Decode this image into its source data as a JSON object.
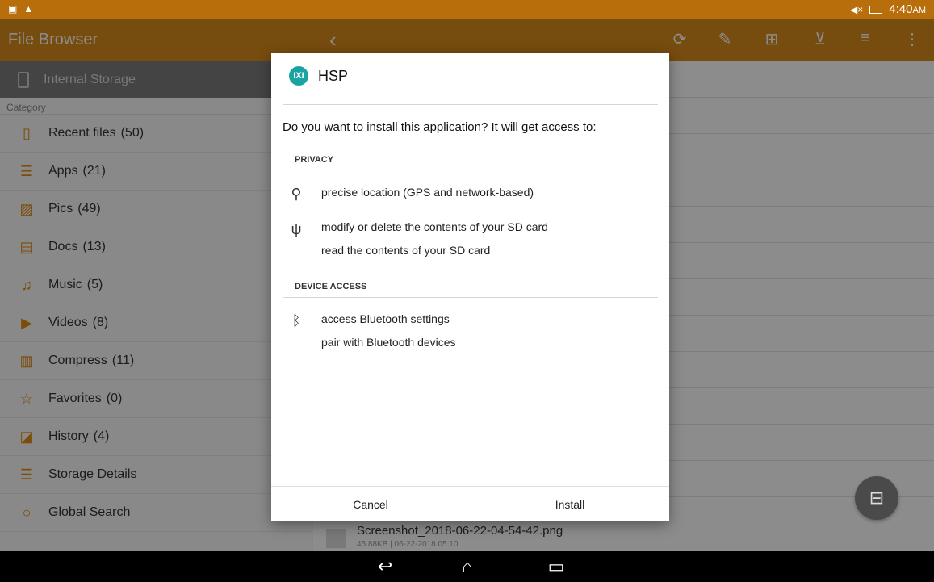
{
  "status_bar": {
    "time": "4:40",
    "ampm": "AM",
    "icons": [
      "image-icon",
      "warning-icon",
      "mute-icon",
      "battery-icon"
    ]
  },
  "app_bar": {
    "title": "File Browser",
    "toolbar_icons": [
      "back-icon",
      "refresh-icon",
      "edit-icon",
      "new-folder-icon",
      "filter-icon",
      "sort-icon",
      "more-icon"
    ]
  },
  "sidebar": {
    "storage_label": "Internal Storage",
    "category_label": "Category",
    "items": [
      {
        "label": "Recent files",
        "count": "(50)",
        "icon": "recent-files-icon"
      },
      {
        "label": "Apps",
        "count": "(21)",
        "icon": "apps-icon"
      },
      {
        "label": "Pics",
        "count": "(49)",
        "icon": "pics-icon"
      },
      {
        "label": "Docs",
        "count": "(13)",
        "icon": "docs-icon"
      },
      {
        "label": "Music",
        "count": "(5)",
        "icon": "music-icon"
      },
      {
        "label": "Videos",
        "count": "(8)",
        "icon": "videos-icon"
      },
      {
        "label": "Compress",
        "count": "(11)",
        "icon": "compress-icon"
      },
      {
        "label": "Favorites",
        "count": "(0)",
        "icon": "star-icon"
      },
      {
        "label": "History",
        "count": "(4)",
        "icon": "history-icon"
      },
      {
        "label": "Storage Details",
        "count": "",
        "icon": "storage-details-icon"
      },
      {
        "label": "Global Search",
        "count": "",
        "icon": "search-icon"
      }
    ]
  },
  "main": {
    "file": {
      "name": "Screenshot_2018-06-22-04-54-42.png",
      "meta": "45.88KB | 06-22-2018 05:10"
    }
  },
  "dialog": {
    "app_name": "HSP",
    "question": "Do you want to install this application? It will get access to:",
    "sections": [
      {
        "title": "PRIVACY"
      },
      {
        "title": "DEVICE ACCESS"
      }
    ],
    "permissions": {
      "location": "precise location (GPS and network-based)",
      "sd_modify": "modify or delete the contents of your SD card",
      "sd_read": "read the contents of your SD card",
      "bt_settings": "access Bluetooth settings",
      "bt_pair": "pair with Bluetooth devices"
    },
    "cancel_label": "Cancel",
    "install_label": "Install"
  },
  "colors": {
    "status_bar": "#b96e0c",
    "app_bar": "#d98b1d",
    "accent": "#e28a12",
    "dialog_logo": "#19a3a3"
  }
}
